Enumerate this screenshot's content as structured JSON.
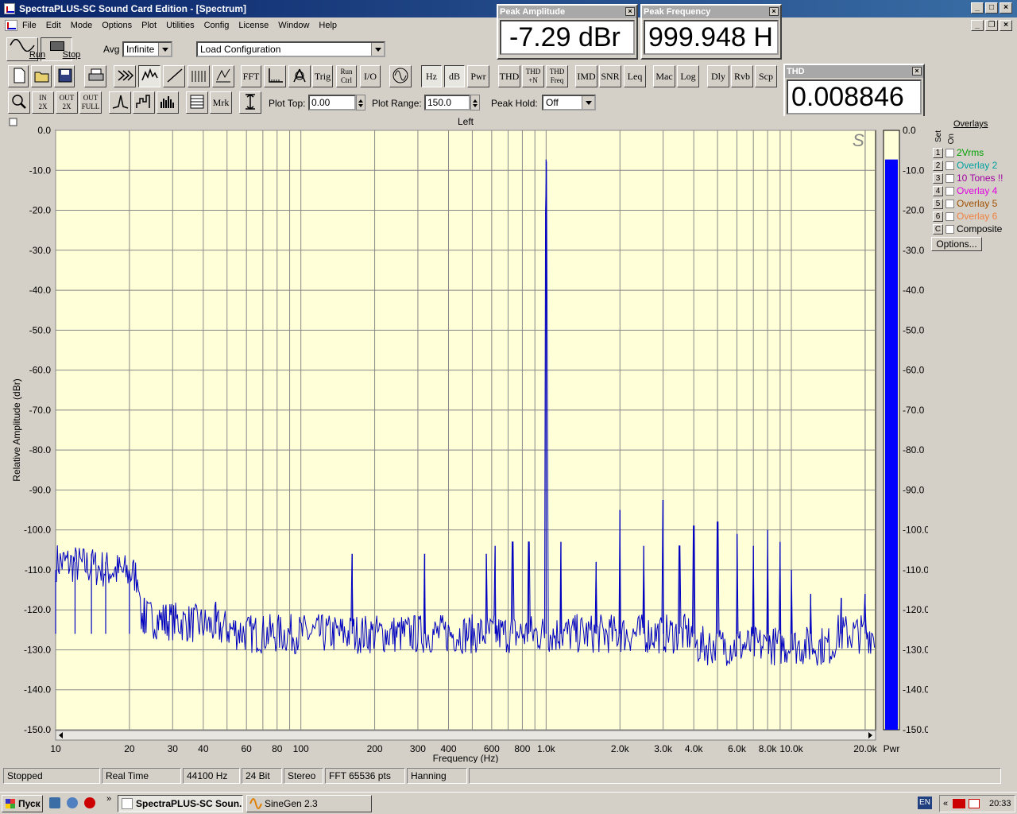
{
  "window": {
    "title": "SpectraPLUS-SC Sound Card Edition - [Spectrum]"
  },
  "menu": [
    "File",
    "Edit",
    "Mode",
    "Options",
    "Plot",
    "Utilities",
    "Config",
    "License",
    "Window",
    "Help"
  ],
  "controls": {
    "run_label": "Run",
    "stop_label": "Stop",
    "avg_label": "Avg",
    "avg_value": "Infinite",
    "config_value": "Load Configuration",
    "plot_top_label": "Plot Top:",
    "plot_top_value": "0.00",
    "plot_range_label": "Plot Range:",
    "plot_range_value": "150.0",
    "peak_hold_label": "Peak Hold:",
    "peak_hold_value": "Off"
  },
  "toolbar2": [
    {
      "label": "FFT"
    },
    {
      "label": "Trig"
    },
    {
      "label": "Run\nCtrl"
    },
    {
      "label": "I/O"
    },
    {
      "label": "Hz"
    },
    {
      "label": "dB"
    },
    {
      "label": "Pwr"
    },
    {
      "label": "THD"
    },
    {
      "label": "THD\n+N"
    },
    {
      "label": "THD\nFreq"
    },
    {
      "label": "IMD"
    },
    {
      "label": "SNR"
    },
    {
      "label": "Leq"
    },
    {
      "label": "Mac"
    },
    {
      "label": "Log"
    },
    {
      "label": "Dly"
    },
    {
      "label": "Rvb"
    },
    {
      "label": "Scp"
    }
  ],
  "toolbar3": [
    {
      "label": "IN\n2X"
    },
    {
      "label": "OUT\n2X"
    },
    {
      "label": "OUT\nFULL"
    },
    {
      "label": "Mrk"
    }
  ],
  "meters": {
    "peak_amplitude": {
      "title": "Peak Amplitude",
      "value": "-7.29 dBr"
    },
    "peak_frequency": {
      "title": "Peak Frequency",
      "value": "999.948 H"
    },
    "thd": {
      "title": "THD",
      "value": "0.008846"
    }
  },
  "overlays": {
    "title": "Overlays",
    "set_label": "Set",
    "on_label": "On",
    "items": [
      {
        "num": "1",
        "label": "2Vrms",
        "color": "#00a000"
      },
      {
        "num": "2",
        "label": "Overlay 2",
        "color": "#00a0a0"
      },
      {
        "num": "3",
        "label": "10 Tones !!",
        "color": "#a000a0"
      },
      {
        "num": "4",
        "label": "Overlay 4",
        "color": "#e000e0"
      },
      {
        "num": "5",
        "label": "Overlay 5",
        "color": "#a05000"
      },
      {
        "num": "6",
        "label": "Overlay 6",
        "color": "#f08040"
      },
      {
        "num": "C",
        "label": "Composite",
        "color": "#000000"
      }
    ],
    "options_label": "Options..."
  },
  "chart_data": {
    "type": "line",
    "title": "Left",
    "xlabel": "Frequency (Hz)",
    "ylabel": "Relative Amplitude (dBr)",
    "xscale": "log",
    "xlim": [
      10,
      22050
    ],
    "ylim": [
      -150,
      0
    ],
    "y_ticks": [
      "0.0",
      "-10.0",
      "-20.0",
      "-30.0",
      "-40.0",
      "-50.0",
      "-60.0",
      "-70.0",
      "-80.0",
      "-90.0",
      "-100.0",
      "-110.0",
      "-120.0",
      "-130.0",
      "-140.0",
      "-150.0"
    ],
    "x_ticks": [
      {
        "v": 10,
        "t": "10"
      },
      {
        "v": 20,
        "t": "20"
      },
      {
        "v": 30,
        "t": "30"
      },
      {
        "v": 40,
        "t": "40"
      },
      {
        "v": 60,
        "t": "60"
      },
      {
        "v": 80,
        "t": "80"
      },
      {
        "v": 100,
        "t": "100"
      },
      {
        "v": 200,
        "t": "200"
      },
      {
        "v": 300,
        "t": "300"
      },
      {
        "v": 400,
        "t": "400"
      },
      {
        "v": 600,
        "t": "600"
      },
      {
        "v": 800,
        "t": "800"
      },
      {
        "v": 1000,
        "t": "1.0k"
      },
      {
        "v": 2000,
        "t": "2.0k"
      },
      {
        "v": 3000,
        "t": "3.0k"
      },
      {
        "v": 4000,
        "t": "4.0k"
      },
      {
        "v": 6000,
        "t": "6.0k"
      },
      {
        "v": 8000,
        "t": "8.0k"
      },
      {
        "v": 10000,
        "t": "10.0k"
      },
      {
        "v": 20000,
        "t": "20.0k"
      }
    ],
    "pwr_label": "Pwr",
    "pwr_level_dbr": -7.29,
    "grid": true,
    "noise_floor_dbr": -126,
    "peaks": [
      {
        "f": 10,
        "db": -110
      },
      {
        "f": 12,
        "db": -108
      },
      {
        "f": 14,
        "db": -106
      },
      {
        "f": 16,
        "db": -108
      },
      {
        "f": 20,
        "db": -111
      },
      {
        "f": 23,
        "db": -117
      },
      {
        "f": 28,
        "db": -120
      },
      {
        "f": 45,
        "db": -118
      },
      {
        "f": 162,
        "db": -106
      },
      {
        "f": 320,
        "db": -106
      },
      {
        "f": 570,
        "db": -106
      },
      {
        "f": 620,
        "db": -104
      },
      {
        "f": 730,
        "db": -103
      },
      {
        "f": 850,
        "db": -103
      },
      {
        "f": 999.948,
        "db": -7.29
      },
      {
        "f": 1150,
        "db": -103
      },
      {
        "f": 1600,
        "db": -108
      },
      {
        "f": 2000,
        "db": -95
      },
      {
        "f": 2500,
        "db": -104
      },
      {
        "f": 3000,
        "db": -92.5
      },
      {
        "f": 3500,
        "db": -104
      },
      {
        "f": 4000,
        "db": -99
      },
      {
        "f": 5000,
        "db": -98
      },
      {
        "f": 6000,
        "db": -101
      },
      {
        "f": 7000,
        "db": -104
      },
      {
        "f": 8000,
        "db": -100
      },
      {
        "f": 9000,
        "db": -103
      },
      {
        "f": 10000,
        "db": -110
      },
      {
        "f": 12000,
        "db": -116
      },
      {
        "f": 16000,
        "db": -117
      },
      {
        "f": 20000,
        "db": -116
      }
    ]
  },
  "status": [
    "Stopped",
    "Real Time",
    "44100 Hz",
    "24 Bit",
    "Stereo",
    "FFT 65536 pts",
    "Hanning"
  ],
  "taskbar": {
    "start_label": "Пуск",
    "tasks": [
      "SpectraPLUS-SC Soun...",
      "SineGen 2.3"
    ],
    "lang": "EN",
    "clock": "20:33"
  }
}
